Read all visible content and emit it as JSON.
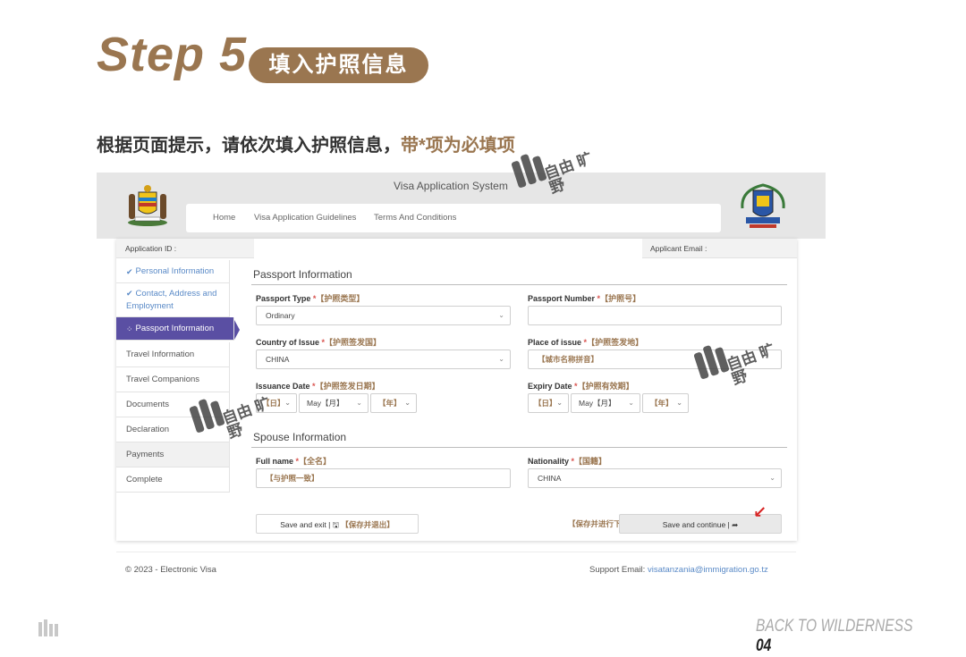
{
  "header": {
    "step": "Step 5",
    "pill": "填入护照信息",
    "instruction": "根据页面提示，请依次填入护照信息，",
    "instruction_accent": "带*项为必填项"
  },
  "site": {
    "title": "Visa Application System",
    "nav": [
      "Home",
      "Visa Application Guidelines",
      "Terms And Conditions"
    ]
  },
  "idbar": {
    "application_id": "Application ID :",
    "applicant_email": "Applicant Email :"
  },
  "sidebar": {
    "items": [
      {
        "label": "Personal Information",
        "state": "done"
      },
      {
        "label": "Contact, Address and Employment",
        "state": "done"
      },
      {
        "label": "Passport Information",
        "state": "active"
      },
      {
        "label": "Travel Information",
        "state": "normal"
      },
      {
        "label": "Travel Companions",
        "state": "normal"
      },
      {
        "label": "Documents",
        "state": "normal"
      },
      {
        "label": "Declaration",
        "state": "normal"
      },
      {
        "label": "Payments",
        "state": "shaded"
      },
      {
        "label": "Complete",
        "state": "normal"
      }
    ]
  },
  "passport": {
    "section_title": "Passport Information",
    "passport_type": {
      "label": "Passport Type",
      "cn": "【护照类型】",
      "value": "Ordinary"
    },
    "passport_number": {
      "label": "Passport Number",
      "cn": "【护照号】",
      "value": ""
    },
    "country_issue": {
      "label": "Country of Issue",
      "cn": "【护照签发国】",
      "value": "CHINA"
    },
    "place_issue": {
      "label": "Place of issue",
      "cn": "【护照签发地】",
      "value": "【城市名称拼音】"
    },
    "issuance_date": {
      "label": "Issuance Date",
      "cn": "【护照签发日期】",
      "day": "【日】",
      "month": "May【月】",
      "year": "【年】"
    },
    "expiry_date": {
      "label": "Expiry Date",
      "cn": "【护照有效期】",
      "day": "【日】",
      "month": "May【月】",
      "year": "【年】"
    }
  },
  "spouse": {
    "section_title": "Spouse Information",
    "full_name": {
      "label": "Full name",
      "cn": "【全名】",
      "value": "【与护照一致】"
    },
    "nationality": {
      "label": "Nationality",
      "cn": "【国籍】",
      "value": "CHINA"
    }
  },
  "actions": {
    "save_exit": "Save and exit |",
    "save_exit_cn": "【保存并退出】",
    "continue_hint": "【保存并进行下一步】",
    "save_continue": "Save and continue |"
  },
  "footer": {
    "copyright": "© 2023 - Electronic Visa",
    "support_label": "Support Email:",
    "support_email": "visatanzania@immigration.go.tz"
  },
  "brand": {
    "text": "BACK TO WILDERNESS",
    "page": "04",
    "watermark": "自由 旷野"
  },
  "colors": {
    "accent": "#9a7650",
    "active_nav": "#5a4fa3",
    "done": "#5a8ac7",
    "arrow": "#d82424"
  }
}
